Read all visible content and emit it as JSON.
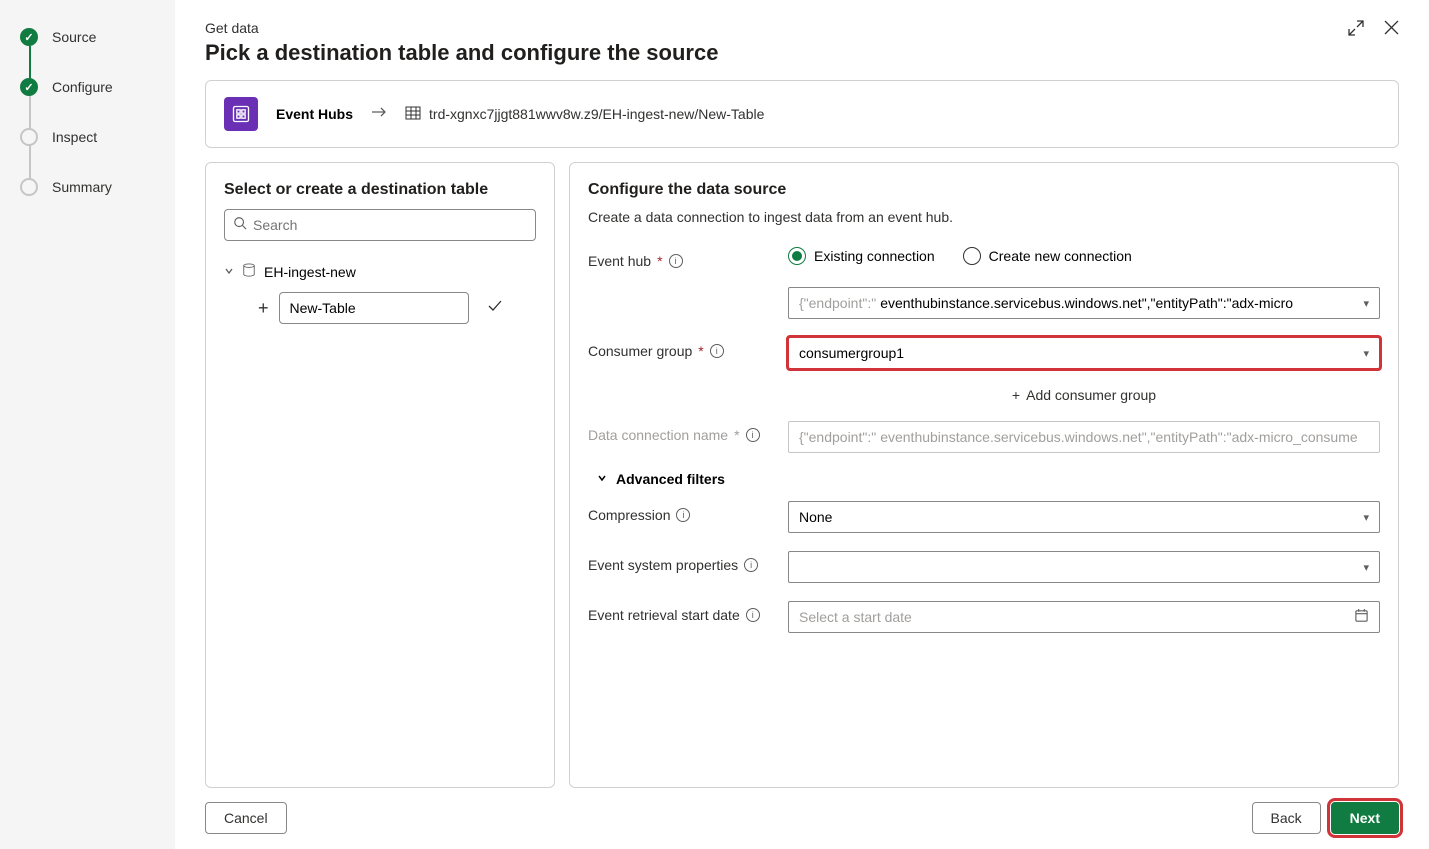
{
  "stepper": {
    "steps": [
      "Source",
      "Configure",
      "Inspect",
      "Summary"
    ]
  },
  "header": {
    "breadcrumb": "Get data",
    "title": "Pick a destination table and configure the source"
  },
  "source_bar": {
    "label": "Event Hubs",
    "dest_path": "trd-xgnxc7jjgt881wwv8w.z9/EH-ingest-new/New-Table"
  },
  "left": {
    "title": "Select or create a destination table",
    "search_placeholder": "Search",
    "db_name": "EH-ingest-new",
    "new_table_value": "New-Table"
  },
  "right": {
    "title": "Configure the data source",
    "subtitle": "Create a data connection to ingest data from an event hub.",
    "event_hub_label": "Event hub",
    "radio_existing": "Existing connection",
    "radio_new": "Create new connection",
    "endpoint_prefix": "{\"endpoint\":\"",
    "endpoint_value": "eventhubinstance.servicebus.windows.net\",\"entityPath\":\"adx-micro",
    "consumer_group_label": "Consumer group",
    "consumer_group_value": "consumergroup1",
    "add_consumer_group": "Add consumer group",
    "data_conn_label": "Data connection name",
    "data_conn_prefix": "{\"endpoint\":\"",
    "data_conn_value": "eventhubinstance.servicebus.windows.net\",\"entityPath\":\"adx-micro_consume",
    "adv_filters": "Advanced filters",
    "compression_label": "Compression",
    "compression_value": "None",
    "esp_label": "Event system properties",
    "esp_value": "",
    "retrieval_label": "Event retrieval start date",
    "retrieval_placeholder": "Select a start date"
  },
  "footer": {
    "cancel": "Cancel",
    "back": "Back",
    "next": "Next"
  }
}
